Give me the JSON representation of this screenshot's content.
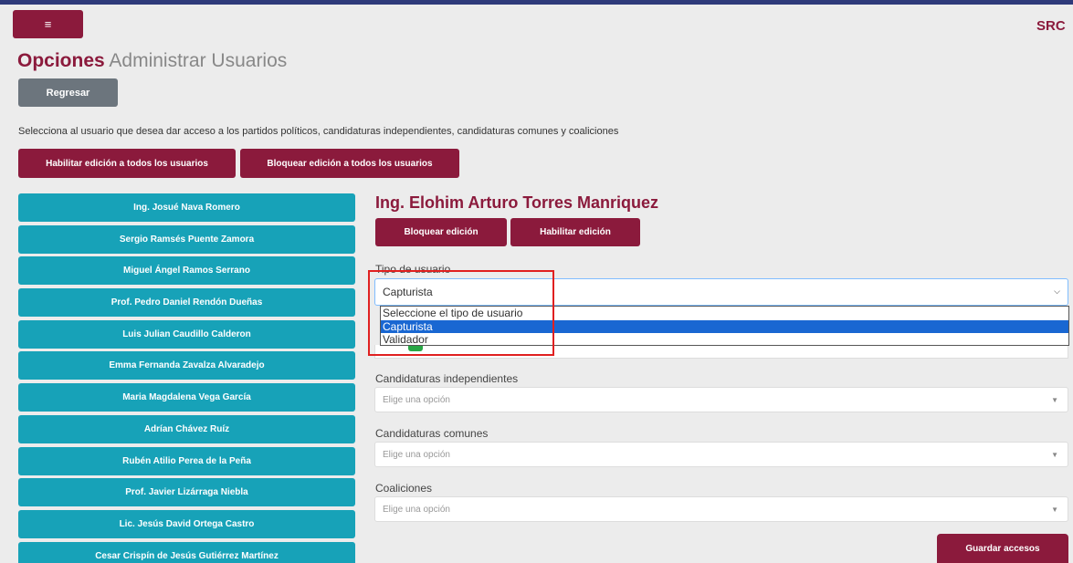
{
  "header": {
    "menu_icon": "≡",
    "brand": "SRC"
  },
  "page": {
    "title_bold": "Opciones",
    "title_rest": "Administrar Usuarios",
    "back_label": "Regresar",
    "instruction": "Selecciona al usuario que desea dar acceso a los partidos políticos, candidaturas independientes, candidaturas comunes y coaliciones",
    "enable_all_label": "Habilitar edición a todos los usuarios",
    "block_all_label": "Bloquear edición a todos los usuarios"
  },
  "users": [
    "Ing. Josué Nava Romero",
    "Sergio Ramsés Puente Zamora",
    "Miguel Ángel Ramos Serrano",
    "Prof. Pedro Daniel Rendón Dueñas",
    "Luis Julian Caudillo Calderon",
    "Emma Fernanda Zavalza Alvaradejo",
    "Maria Magdalena Vega García",
    "Adrían Chávez Ruíz",
    "Rubén Atilio Perea de la Peña",
    "Prof. Javier Lizárraga Niebla",
    "Lic. Jesús David Ortega Castro",
    "Cesar Crispín de Jesús Gutiérrez Martínez"
  ],
  "detail": {
    "user_name": "Ing. Elohim Arturo Torres Manriquez",
    "block_label": "Bloquear edición",
    "enable_label": "Habilitar edición",
    "tipo_label": "Tipo de usuario",
    "tipo_value": "Capturista",
    "tipo_options": [
      "Seleccione el tipo de usuario",
      "Capturista",
      "Validador"
    ],
    "independientes_label": "Candidaturas independientes",
    "comunes_label": "Candidaturas comunes",
    "coaliciones_label": "Coaliciones",
    "placeholder": "Elige una opción",
    "save_label": "Guardar accesos"
  },
  "colors": {
    "primary": "#8b1a3c",
    "user_button": "#17a2b8",
    "secondary": "#6c757d",
    "dropdown_selected": "#1967d2",
    "highlight": "#e02020"
  }
}
